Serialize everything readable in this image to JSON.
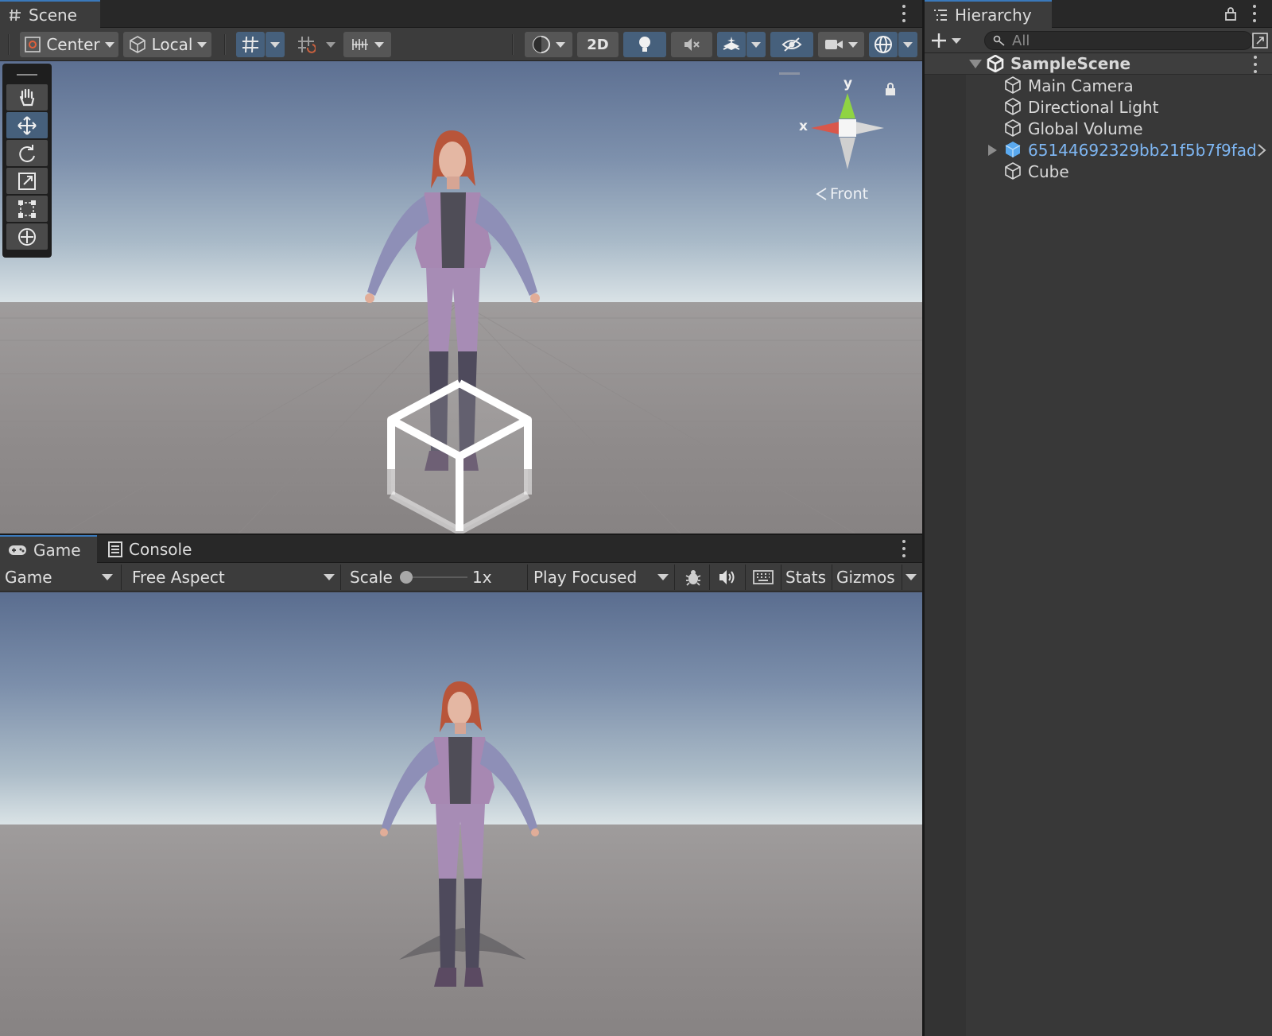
{
  "scene_panel": {
    "tab_label": "Scene",
    "pivot_mode": "Center",
    "pivot_rotation": "Local",
    "view_2d_label": "2D",
    "orientation_label": "Front",
    "axis_x": "x",
    "axis_y": "y"
  },
  "game_panel": {
    "tab_game": "Game",
    "tab_console": "Console",
    "display_dropdown": "Game",
    "aspect_dropdown": "Free Aspect",
    "scale_label": "Scale",
    "scale_value": "1x",
    "scale_fraction": 0.0,
    "play_mode_dropdown": "Play Focused",
    "stats_button": "Stats",
    "gizmos_button": "Gizmos"
  },
  "hierarchy": {
    "tab_label": "Hierarchy",
    "search_placeholder": "All",
    "scene_name": "SampleScene",
    "items": [
      {
        "label": "Main Camera",
        "prefab": false
      },
      {
        "label": "Directional Light",
        "prefab": false
      },
      {
        "label": "Global Volume",
        "prefab": false
      },
      {
        "label": "65144692329bb21f5b7f9fad",
        "prefab": true
      },
      {
        "label": "Cube",
        "prefab": false
      }
    ]
  },
  "colors": {
    "accent_blue": "#46607c",
    "prefab_blue": "#7eb6f2",
    "panel_bg": "#383838",
    "axis_x": "#d9574a",
    "axis_y": "#8fd442"
  }
}
